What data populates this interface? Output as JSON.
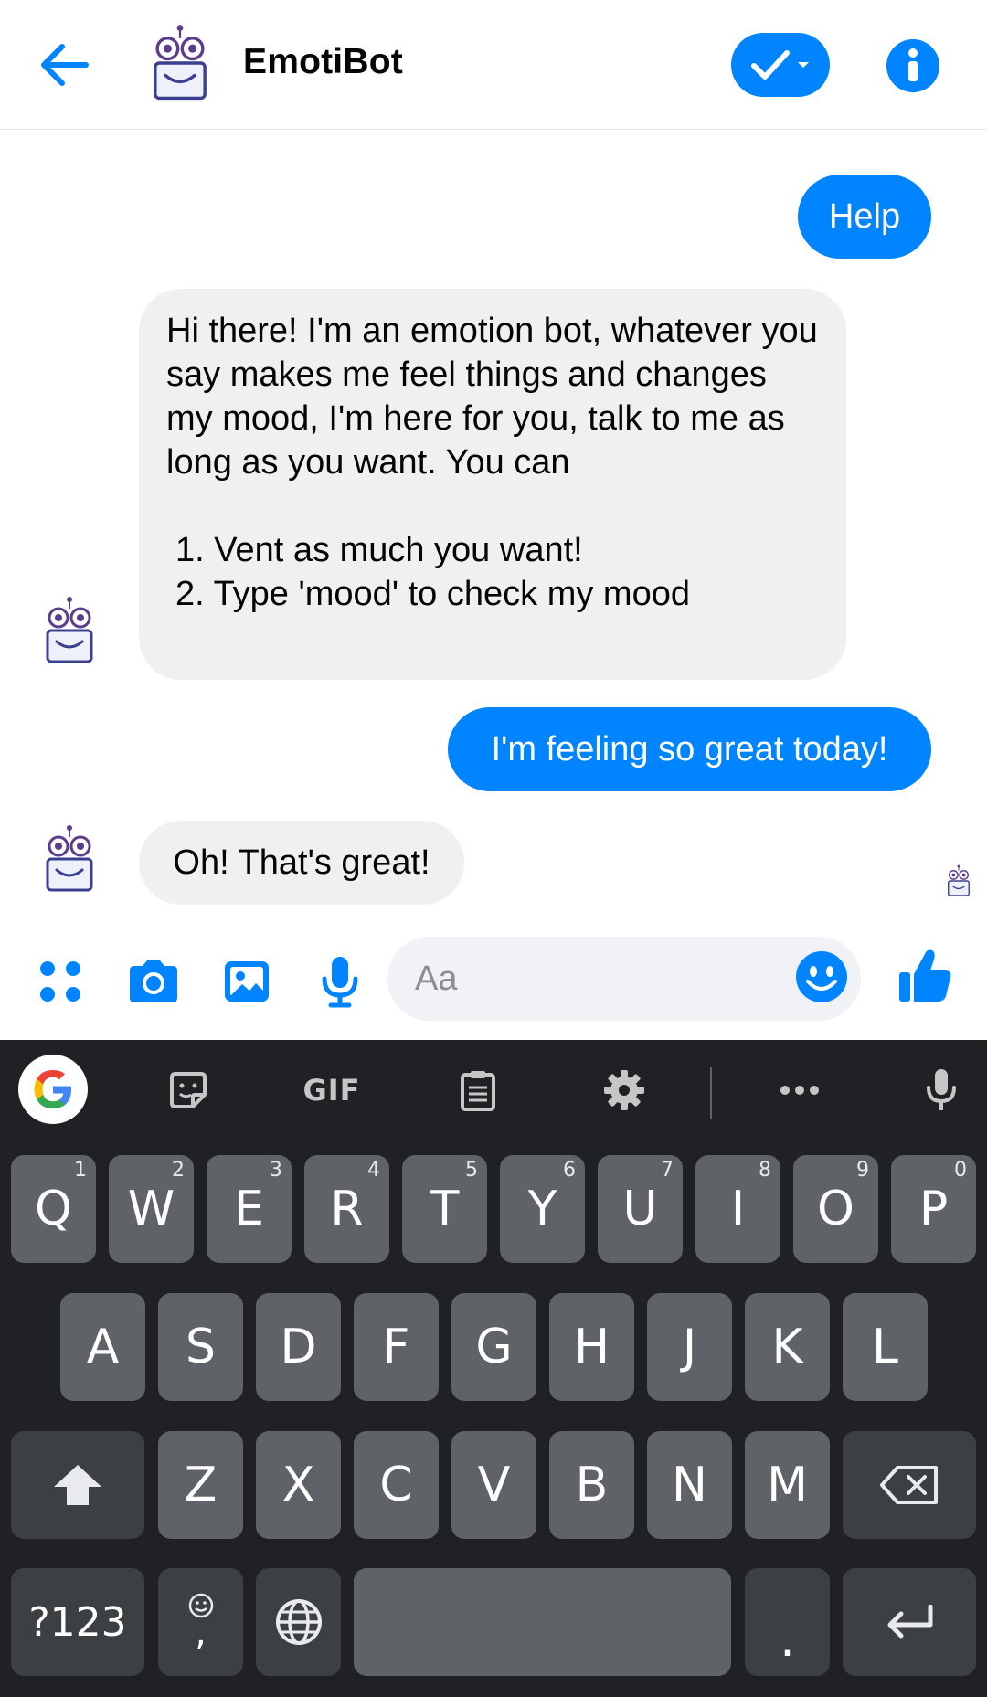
{
  "header": {
    "title": "EmotiBot",
    "back_icon": "arrow-left-icon",
    "status_icon": "check-icon",
    "info_icon": "info-icon"
  },
  "messages": [
    {
      "from": "user",
      "text": "Help"
    },
    {
      "from": "bot",
      "intro": "Hi there! I'm an emotion bot, whatever you say makes me feel things and changes my mood, I'm here for you, talk to me as long as you want. You can",
      "list": [
        "1. Vent as much you want!",
        "2. Type 'mood' to check my mood"
      ]
    },
    {
      "from": "user",
      "text": "I'm feeling so great today!"
    },
    {
      "from": "bot",
      "text": "Oh! That's great!"
    }
  ],
  "composer": {
    "placeholder": "Aa",
    "icons": [
      "apps-icon",
      "camera-icon",
      "image-icon",
      "microphone-icon",
      "emoji-icon",
      "thumbs-up-icon"
    ]
  },
  "keyboard": {
    "toolbar": {
      "gif_label": "GIF"
    },
    "row1": [
      {
        "key": "Q",
        "hint": "1"
      },
      {
        "key": "W",
        "hint": "2"
      },
      {
        "key": "E",
        "hint": "3"
      },
      {
        "key": "R",
        "hint": "4"
      },
      {
        "key": "T",
        "hint": "5"
      },
      {
        "key": "Y",
        "hint": "6"
      },
      {
        "key": "U",
        "hint": "7"
      },
      {
        "key": "I",
        "hint": "8"
      },
      {
        "key": "O",
        "hint": "9"
      },
      {
        "key": "P",
        "hint": "0"
      }
    ],
    "row2": [
      "A",
      "S",
      "D",
      "F",
      "G",
      "H",
      "J",
      "K",
      "L"
    ],
    "row3": [
      "Z",
      "X",
      "C",
      "V",
      "B",
      "N",
      "M"
    ],
    "symbols_label": "?123",
    "comma_label": ",",
    "period_label": "."
  },
  "colors": {
    "accent": "#0084ff",
    "incoming_bubble": "#f0f0f0",
    "keyboard_bg": "#202124",
    "key_bg": "#5f6368",
    "key_dark_bg": "#3c4043"
  }
}
